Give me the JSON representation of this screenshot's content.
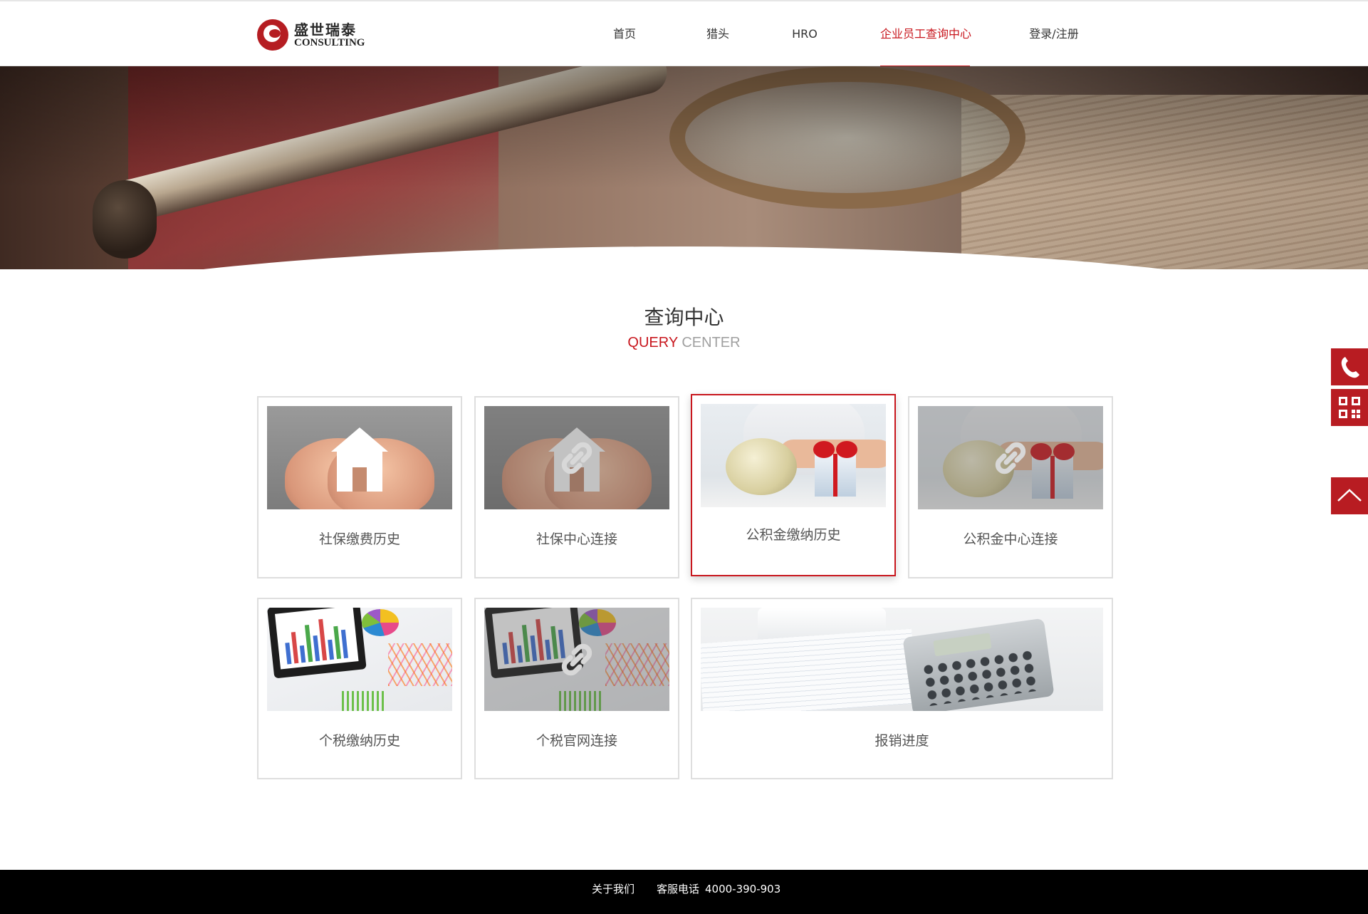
{
  "header": {
    "logo_cn": "盛世瑞泰",
    "logo_en": "CONSULTING",
    "nav": [
      {
        "label": "首页",
        "active": false
      },
      {
        "label": "猎头",
        "active": false
      },
      {
        "label": "HRO",
        "active": false
      },
      {
        "label": "企业员工查询中心",
        "active": true
      },
      {
        "label": "登录/注册",
        "active": false
      }
    ]
  },
  "section": {
    "title": "查询中心",
    "sub_red": "QUERY",
    "sub_grey": "CENTER"
  },
  "cards": [
    {
      "label": "社保缴费历史",
      "image": "hands-house",
      "link_overlay": false,
      "active": false
    },
    {
      "label": "社保中心连接",
      "image": "hands-house",
      "link_overlay": true,
      "active": false
    },
    {
      "label": "公积金缴纳历史",
      "image": "piggy-bank-gift",
      "link_overlay": false,
      "active": true
    },
    {
      "label": "公积金中心连接",
      "image": "piggy-bank-gift",
      "link_overlay": true,
      "active": false
    },
    {
      "label": "个税缴纳历史",
      "image": "tablet-charts",
      "link_overlay": false,
      "active": false
    },
    {
      "label": "个税官网连接",
      "image": "tablet-charts",
      "link_overlay": true,
      "active": false
    },
    {
      "label": "报销进度",
      "image": "calculator-receipts",
      "link_overlay": false,
      "active": false
    }
  ],
  "float_bar": {
    "icons": [
      "phone-icon",
      "qrcode-icon",
      "back-to-top-icon"
    ]
  },
  "footer": {
    "about": "关于我们",
    "hotline_label": "客服电话",
    "hotline_number": "4000-390-903"
  },
  "colors": {
    "brand_red": "#c8161d",
    "float_red": "#b81c22",
    "footer_bg": "#000000"
  }
}
